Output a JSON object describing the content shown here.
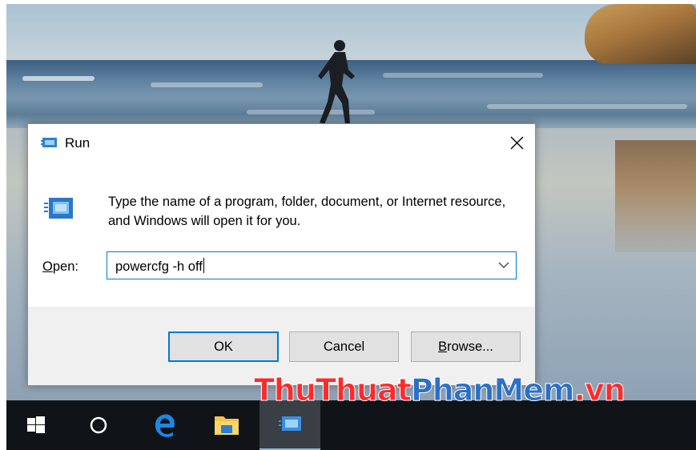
{
  "dialog": {
    "title": "Run",
    "description": "Type the name of a program, folder, document, or Internet resource, and Windows will open it for you.",
    "open_label_accel": "O",
    "open_label_rest": "pen:",
    "command_value": "powercfg -h off",
    "buttons": {
      "ok": "OK",
      "cancel": "Cancel",
      "browse_accel": "B",
      "browse_rest": "rowse..."
    }
  },
  "watermark": {
    "part1": "ThuThuat",
    "part2": "PhanMem",
    "part3": ".vn"
  },
  "taskbar": {
    "items": [
      "start-windows-icon",
      "cortana-circle-icon",
      "edge-browser-icon",
      "file-explorer-icon",
      "run-app-icon"
    ],
    "active_item": "run-app-icon"
  },
  "colors": {
    "accent": "#0078d7",
    "taskbar": "#101418",
    "watermark_red": "#ff2a2a",
    "watermark_blue": "#2b6fc7"
  }
}
